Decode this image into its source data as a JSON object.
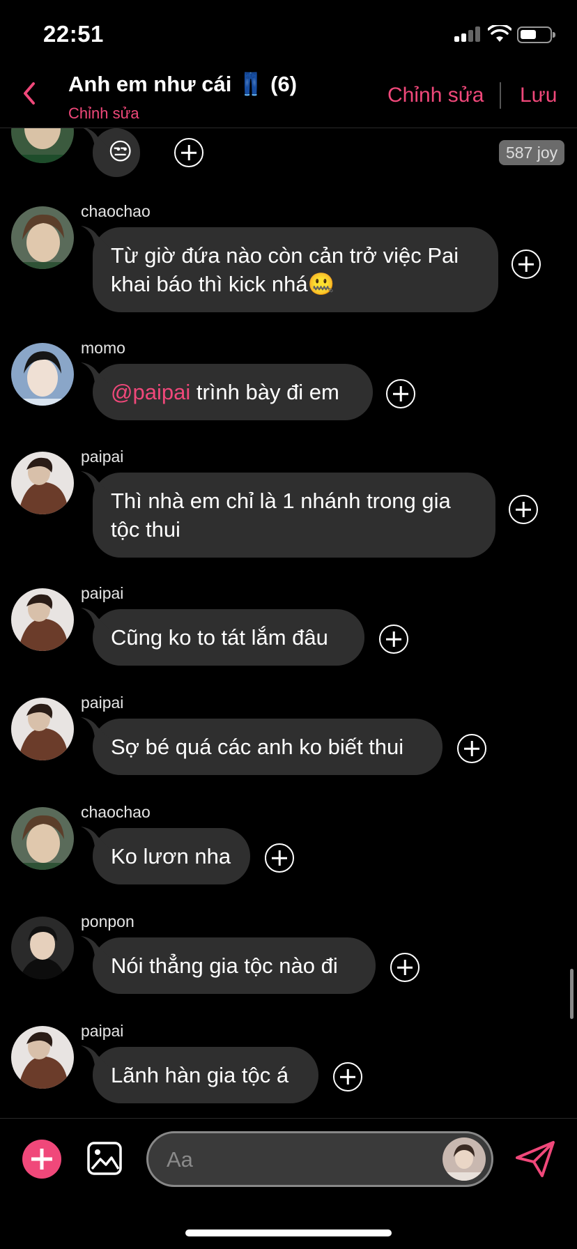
{
  "status_bar": {
    "time": "22:51"
  },
  "header": {
    "title": "Anh em như cái 👖 (6)",
    "subtitle": "Chỉnh sửa",
    "edit_label": "Chỉnh sửa",
    "save_label": "Lưu",
    "accent": "#f0487a"
  },
  "chat": {
    "joy_badge": "587 joy",
    "first_emoji": "😒",
    "messages": [
      {
        "sender": "chaochao",
        "text": "Từ giờ đứa nào còn cản trở việc Pai khai báo thì kick nhá🤐"
      },
      {
        "sender": "momo",
        "mention": "@paipai",
        "text": " trình bày đi em"
      },
      {
        "sender": "paipai",
        "text": "Thì nhà em chỉ là 1 nhánh trong gia tộc thui"
      },
      {
        "sender": "paipai",
        "text": "Cũng ko to tát lắm đâu"
      },
      {
        "sender": "paipai",
        "text": "Sợ bé quá các anh ko biết thui"
      },
      {
        "sender": "chaochao",
        "text": "Ko lươn nha"
      },
      {
        "sender": "ponpon",
        "text": "Nói thẳng gia tộc nào đi"
      },
      {
        "sender": "paipai",
        "text": "Lãnh hàn gia tộc á"
      }
    ]
  },
  "composer": {
    "placeholder": "Aa"
  },
  "icons": {
    "back": "chevron-left-icon",
    "add": "plus-icon",
    "image": "image-icon",
    "send": "send-icon",
    "react": "add-reaction-icon"
  }
}
